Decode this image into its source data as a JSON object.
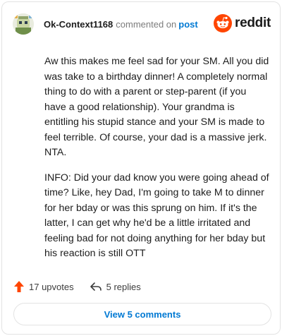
{
  "header": {
    "username": "Ok-Context1168",
    "action_text": "commented on",
    "post_link": "post",
    "brand": "reddit"
  },
  "comment": {
    "paragraphs": [
      "Aw this makes me feel sad for your SM. All you did was take to a birthday dinner! A completely normal thing to do with a parent or step-parent (if you have a good relationship). Your grandma is entitling his stupid stance and your SM is made to feel terrible. Of course, your dad is a massive jerk. NTA.",
      "INFO: Did your dad know you were going ahead of time? Like, hey Dad, I'm going to take M to dinner for her bday or was this sprung on him. If it's the latter, I can get why he'd be a little irritated and feeling bad for not doing anything for her bday but his reaction is still OTT"
    ]
  },
  "actions": {
    "upvotes": "17 upvotes",
    "replies": "5 replies",
    "upvote_icon": "upvote-arrow-icon",
    "reply_icon": "reply-arrow-icon"
  },
  "footer": {
    "view_comments": "View 5 comments"
  },
  "colors": {
    "upvote": "#ff4500",
    "link": "#0079d3",
    "brand": "#ff4500"
  }
}
